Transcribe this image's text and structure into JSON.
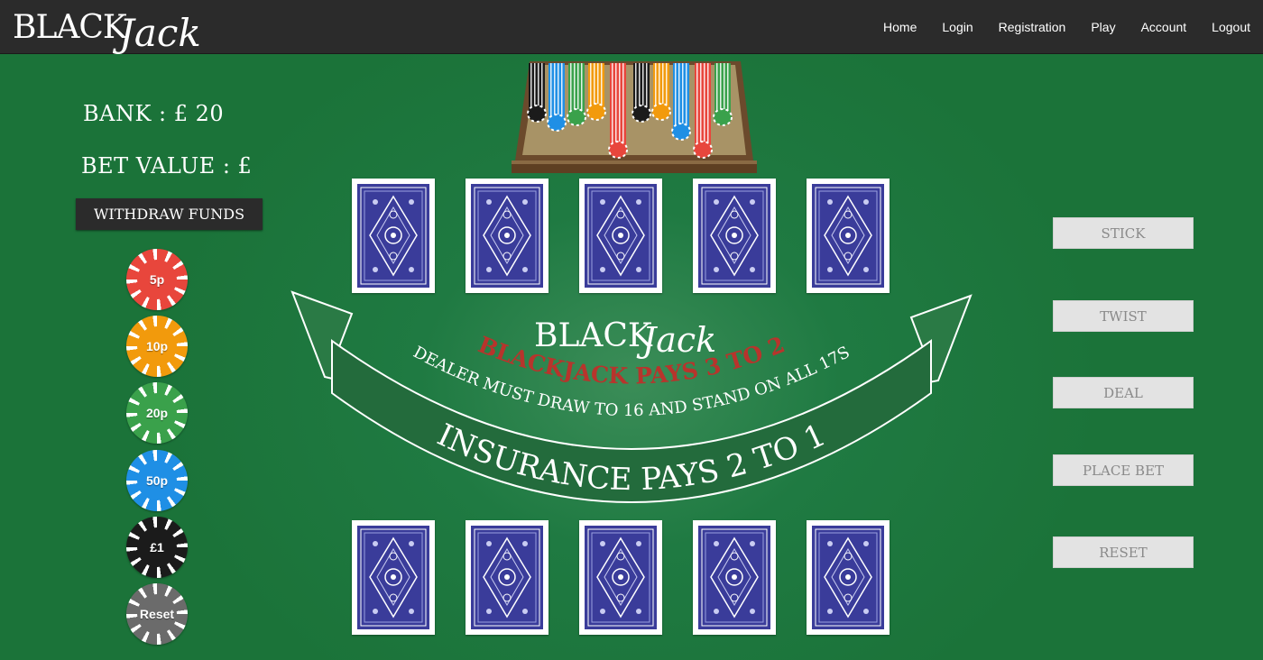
{
  "brand": {
    "black": "BLACK",
    "jack": "Jack"
  },
  "nav": {
    "home": "Home",
    "login": "Login",
    "registration": "Registration",
    "play": "Play",
    "account": "Account",
    "logout": "Logout"
  },
  "wallet": {
    "bank_label": "BANK : £ 20",
    "bet_label": "BET VALUE : £",
    "withdraw_label": "WITHDRAW FUNDS"
  },
  "chips": [
    {
      "label": "5p",
      "color": "#e8463c"
    },
    {
      "label": "10p",
      "color": "#f29a0c"
    },
    {
      "label": "20p",
      "color": "#3aa14b"
    },
    {
      "label": "50p",
      "color": "#1f8fe5"
    },
    {
      "label": "£1",
      "color": "#1b1b1b"
    },
    {
      "label": "Reset",
      "color": "#6b6b6b"
    }
  ],
  "table": {
    "logo_black": "BLACK",
    "logo_jack": "Jack",
    "pays_text": "BLACKJACK PAYS 3 TO 2",
    "dealer_text": "DEALER MUST DRAW TO 16 AND STAND ON ALL 17S",
    "insurance_text": "INSURANCE PAYS 2 TO 1"
  },
  "actions": {
    "stick": "STICK",
    "twist": "TWIST",
    "deal": "DEAL",
    "place_bet": "PLACE BET",
    "reset": "RESET"
  },
  "colors": {
    "felt": "#1f7a42",
    "nav": "#2b2b2b",
    "card_back": "#3a3c9a",
    "ribbon": "#236b3c",
    "pays_red": "#b8342c"
  }
}
